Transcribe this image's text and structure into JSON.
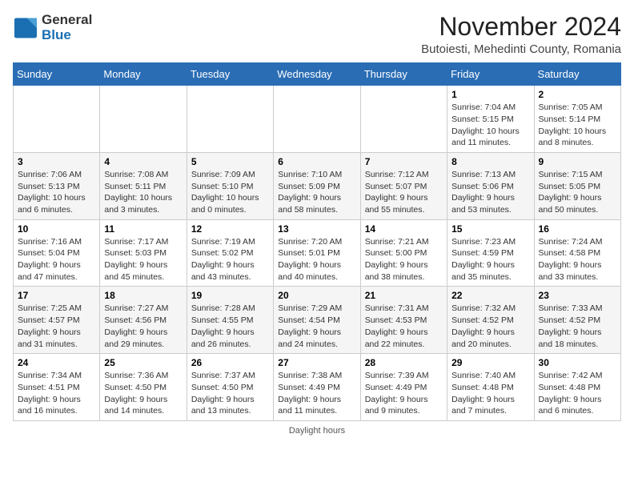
{
  "header": {
    "logo_line1": "General",
    "logo_line2": "Blue",
    "title": "November 2024",
    "subtitle": "Butoiesti, Mehedinti County, Romania"
  },
  "days_of_week": [
    "Sunday",
    "Monday",
    "Tuesday",
    "Wednesday",
    "Thursday",
    "Friday",
    "Saturday"
  ],
  "weeks": [
    [
      {
        "day": "",
        "info": ""
      },
      {
        "day": "",
        "info": ""
      },
      {
        "day": "",
        "info": ""
      },
      {
        "day": "",
        "info": ""
      },
      {
        "day": "",
        "info": ""
      },
      {
        "day": "1",
        "info": "Sunrise: 7:04 AM\nSunset: 5:15 PM\nDaylight: 10 hours and 11 minutes."
      },
      {
        "day": "2",
        "info": "Sunrise: 7:05 AM\nSunset: 5:14 PM\nDaylight: 10 hours and 8 minutes."
      }
    ],
    [
      {
        "day": "3",
        "info": "Sunrise: 7:06 AM\nSunset: 5:13 PM\nDaylight: 10 hours and 6 minutes."
      },
      {
        "day": "4",
        "info": "Sunrise: 7:08 AM\nSunset: 5:11 PM\nDaylight: 10 hours and 3 minutes."
      },
      {
        "day": "5",
        "info": "Sunrise: 7:09 AM\nSunset: 5:10 PM\nDaylight: 10 hours and 0 minutes."
      },
      {
        "day": "6",
        "info": "Sunrise: 7:10 AM\nSunset: 5:09 PM\nDaylight: 9 hours and 58 minutes."
      },
      {
        "day": "7",
        "info": "Sunrise: 7:12 AM\nSunset: 5:07 PM\nDaylight: 9 hours and 55 minutes."
      },
      {
        "day": "8",
        "info": "Sunrise: 7:13 AM\nSunset: 5:06 PM\nDaylight: 9 hours and 53 minutes."
      },
      {
        "day": "9",
        "info": "Sunrise: 7:15 AM\nSunset: 5:05 PM\nDaylight: 9 hours and 50 minutes."
      }
    ],
    [
      {
        "day": "10",
        "info": "Sunrise: 7:16 AM\nSunset: 5:04 PM\nDaylight: 9 hours and 47 minutes."
      },
      {
        "day": "11",
        "info": "Sunrise: 7:17 AM\nSunset: 5:03 PM\nDaylight: 9 hours and 45 minutes."
      },
      {
        "day": "12",
        "info": "Sunrise: 7:19 AM\nSunset: 5:02 PM\nDaylight: 9 hours and 43 minutes."
      },
      {
        "day": "13",
        "info": "Sunrise: 7:20 AM\nSunset: 5:01 PM\nDaylight: 9 hours and 40 minutes."
      },
      {
        "day": "14",
        "info": "Sunrise: 7:21 AM\nSunset: 5:00 PM\nDaylight: 9 hours and 38 minutes."
      },
      {
        "day": "15",
        "info": "Sunrise: 7:23 AM\nSunset: 4:59 PM\nDaylight: 9 hours and 35 minutes."
      },
      {
        "day": "16",
        "info": "Sunrise: 7:24 AM\nSunset: 4:58 PM\nDaylight: 9 hours and 33 minutes."
      }
    ],
    [
      {
        "day": "17",
        "info": "Sunrise: 7:25 AM\nSunset: 4:57 PM\nDaylight: 9 hours and 31 minutes."
      },
      {
        "day": "18",
        "info": "Sunrise: 7:27 AM\nSunset: 4:56 PM\nDaylight: 9 hours and 29 minutes."
      },
      {
        "day": "19",
        "info": "Sunrise: 7:28 AM\nSunset: 4:55 PM\nDaylight: 9 hours and 26 minutes."
      },
      {
        "day": "20",
        "info": "Sunrise: 7:29 AM\nSunset: 4:54 PM\nDaylight: 9 hours and 24 minutes."
      },
      {
        "day": "21",
        "info": "Sunrise: 7:31 AM\nSunset: 4:53 PM\nDaylight: 9 hours and 22 minutes."
      },
      {
        "day": "22",
        "info": "Sunrise: 7:32 AM\nSunset: 4:52 PM\nDaylight: 9 hours and 20 minutes."
      },
      {
        "day": "23",
        "info": "Sunrise: 7:33 AM\nSunset: 4:52 PM\nDaylight: 9 hours and 18 minutes."
      }
    ],
    [
      {
        "day": "24",
        "info": "Sunrise: 7:34 AM\nSunset: 4:51 PM\nDaylight: 9 hours and 16 minutes."
      },
      {
        "day": "25",
        "info": "Sunrise: 7:36 AM\nSunset: 4:50 PM\nDaylight: 9 hours and 14 minutes."
      },
      {
        "day": "26",
        "info": "Sunrise: 7:37 AM\nSunset: 4:50 PM\nDaylight: 9 hours and 13 minutes."
      },
      {
        "day": "27",
        "info": "Sunrise: 7:38 AM\nSunset: 4:49 PM\nDaylight: 9 hours and 11 minutes."
      },
      {
        "day": "28",
        "info": "Sunrise: 7:39 AM\nSunset: 4:49 PM\nDaylight: 9 hours and 9 minutes."
      },
      {
        "day": "29",
        "info": "Sunrise: 7:40 AM\nSunset: 4:48 PM\nDaylight: 9 hours and 7 minutes."
      },
      {
        "day": "30",
        "info": "Sunrise: 7:42 AM\nSunset: 4:48 PM\nDaylight: 9 hours and 6 minutes."
      }
    ]
  ],
  "footer": "Daylight hours"
}
